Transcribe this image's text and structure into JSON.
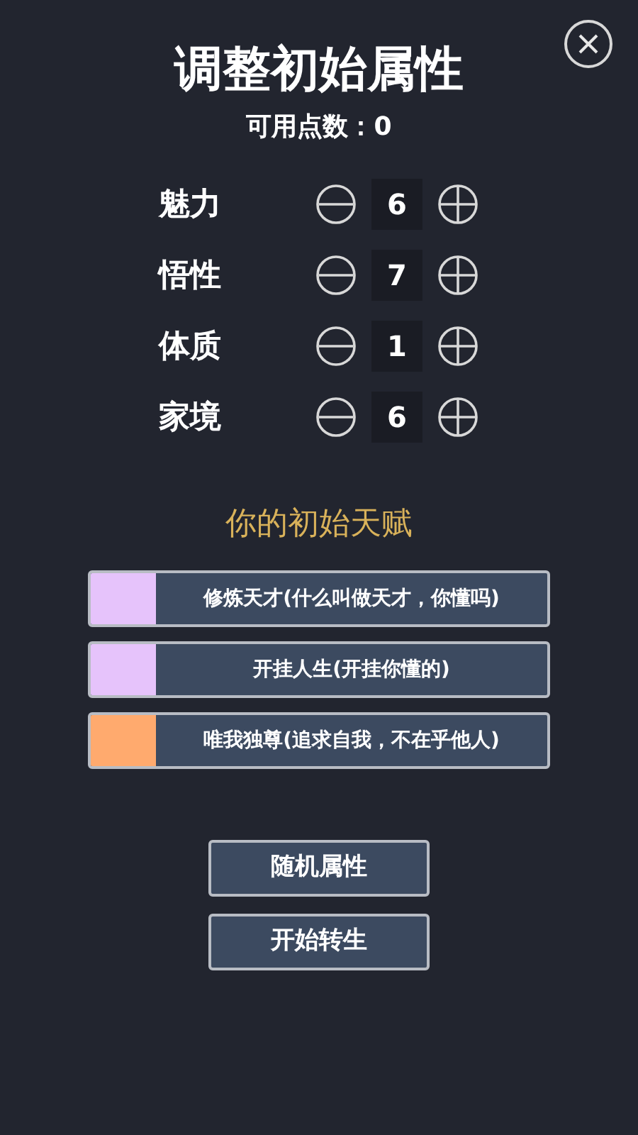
{
  "title": "调整初始属性",
  "points": "可用点数：0",
  "attributes": [
    {
      "label": "魅力",
      "value": "6"
    },
    {
      "label": "悟性",
      "value": "7"
    },
    {
      "label": "体质",
      "value": "1"
    },
    {
      "label": "家境",
      "value": "6"
    }
  ],
  "talents_heading": "你的初始天赋",
  "talents": [
    {
      "label": "修炼天才(什么叫做天才，你懂吗)",
      "color": "#e6c3fb"
    },
    {
      "label": "开挂人生(开挂你懂的)",
      "color": "#e6c3fb"
    },
    {
      "label": "唯我独尊(追求自我，不在乎他人)",
      "color": "#ffaa6e"
    }
  ],
  "buttons": [
    "随机属性",
    "开始转生"
  ]
}
